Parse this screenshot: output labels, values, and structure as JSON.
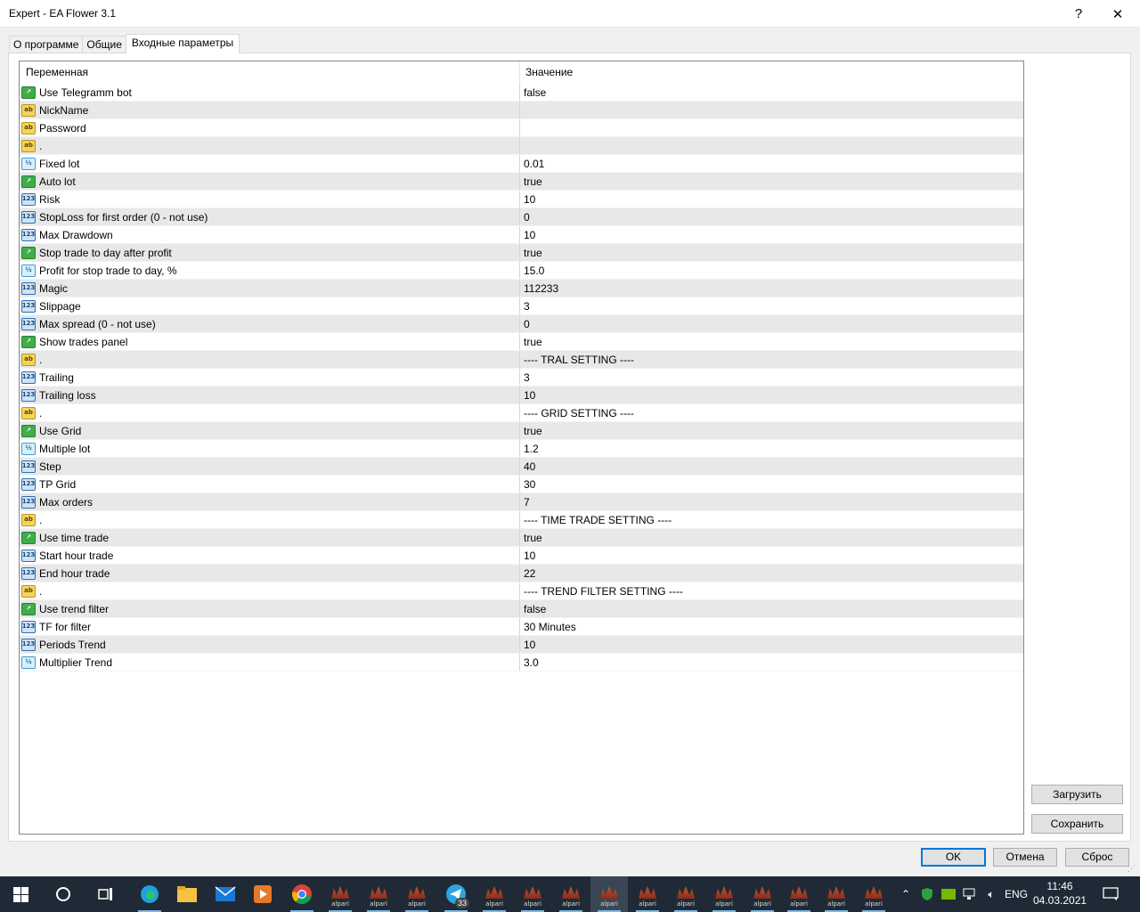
{
  "window": {
    "title": "Expert - EA Flower 3.1",
    "help": "?",
    "close": "✕"
  },
  "tabs": [
    {
      "label": "О программе"
    },
    {
      "label": "Общие"
    },
    {
      "label": "Входные параметры"
    }
  ],
  "list": {
    "header": {
      "variable": "Переменная",
      "value": "Значение"
    },
    "rows": [
      {
        "type": "bool",
        "name": "Use Telegramm bot",
        "value": "false"
      },
      {
        "type": "string",
        "name": "NickName",
        "value": ""
      },
      {
        "type": "string",
        "name": "Password",
        "value": ""
      },
      {
        "type": "string",
        "name": ".",
        "value": ""
      },
      {
        "type": "double",
        "name": "Fixed lot",
        "value": "0.01"
      },
      {
        "type": "bool",
        "name": "Auto lot",
        "value": "true"
      },
      {
        "type": "int",
        "name": "Risk",
        "value": "10"
      },
      {
        "type": "int",
        "name": "StopLoss for first order (0 - not use)",
        "value": "0"
      },
      {
        "type": "int",
        "name": "Max Drawdown",
        "value": "10"
      },
      {
        "type": "bool",
        "name": "Stop trade to day after profit",
        "value": "true"
      },
      {
        "type": "double",
        "name": "Profit for stop trade to day, %",
        "value": "15.0"
      },
      {
        "type": "int",
        "name": "Magic",
        "value": "112233"
      },
      {
        "type": "int",
        "name": "Slippage",
        "value": "3"
      },
      {
        "type": "int",
        "name": "Max spread (0 - not use)",
        "value": "0"
      },
      {
        "type": "bool",
        "name": "Show trades panel",
        "value": "true"
      },
      {
        "type": "string",
        "name": ".",
        "value": "---- TRAL SETTING ----"
      },
      {
        "type": "int",
        "name": "Trailing",
        "value": "3"
      },
      {
        "type": "int",
        "name": "Trailing loss",
        "value": "10"
      },
      {
        "type": "string",
        "name": ".",
        "value": "---- GRID SETTING ----"
      },
      {
        "type": "bool",
        "name": "Use Grid",
        "value": "true"
      },
      {
        "type": "double",
        "name": "Multiple lot",
        "value": "1.2"
      },
      {
        "type": "int",
        "name": "Step",
        "value": "40"
      },
      {
        "type": "int",
        "name": "TP Grid",
        "value": "30"
      },
      {
        "type": "int",
        "name": "Max orders",
        "value": "7"
      },
      {
        "type": "string",
        "name": ".",
        "value": "---- TIME TRADE SETTING ----"
      },
      {
        "type": "bool",
        "name": "Use time trade",
        "value": "true"
      },
      {
        "type": "int",
        "name": "Start hour trade",
        "value": "10"
      },
      {
        "type": "int",
        "name": "End hour trade",
        "value": "22"
      },
      {
        "type": "string",
        "name": ".",
        "value": "---- TREND FILTER SETTING ----"
      },
      {
        "type": "bool",
        "name": "Use trend filter",
        "value": "false"
      },
      {
        "type": "int",
        "name": "TF for filter",
        "value": "30 Minutes"
      },
      {
        "type": "int",
        "name": "Periods Trend",
        "value": "10"
      },
      {
        "type": "double",
        "name": "Multiplier Trend",
        "value": "3.0"
      }
    ]
  },
  "icon_glyphs": {
    "bool": "↗",
    "string": "ab",
    "double": "½",
    "int": "123"
  },
  "buttons": {
    "load": "Загрузить",
    "save": "Сохранить",
    "ok": "OK",
    "cancel": "Отмена",
    "reset": "Сброс"
  },
  "taskbar": {
    "apps": [
      "start",
      "cortana",
      "task-view",
      "edge",
      "explorer",
      "mail",
      "media-player",
      "chrome",
      "alpari",
      "alpari",
      "alpari",
      "telegram",
      "alpari",
      "alpari",
      "alpari",
      "alpari",
      "alpari",
      "alpari",
      "alpari",
      "alpari",
      "alpari",
      "alpari",
      "alpari"
    ],
    "alpari_label": "alpari",
    "telegram_badge": "33",
    "language": "ENG",
    "time": "11:46",
    "date": "04.03.2021"
  }
}
